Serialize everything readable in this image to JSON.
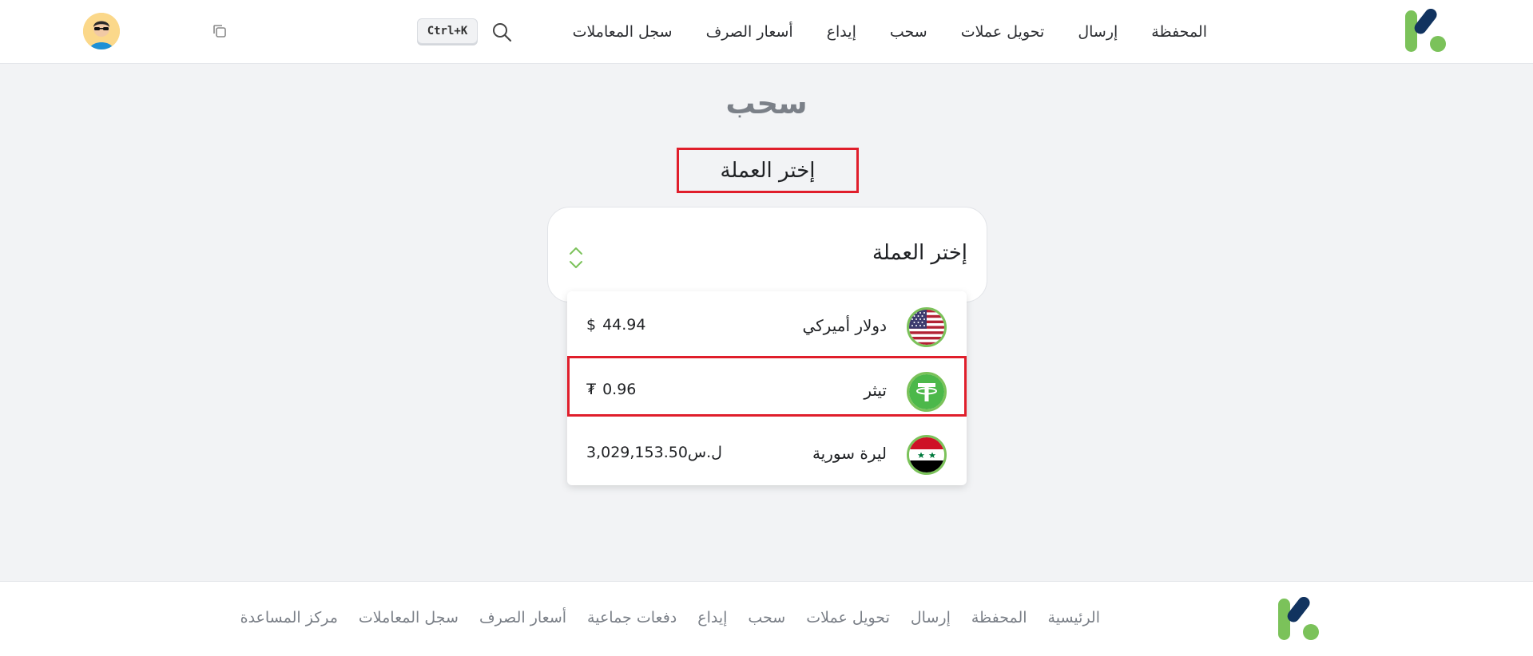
{
  "header": {
    "nav": [
      {
        "label": "المحفظة"
      },
      {
        "label": "إرسال"
      },
      {
        "label": "تحويل عملات"
      },
      {
        "label": "سحب"
      },
      {
        "label": "إيداع"
      },
      {
        "label": "أسعار الصرف"
      },
      {
        "label": "سجل المعاملات"
      }
    ],
    "shortcut": "Ctrl+K"
  },
  "main": {
    "title": "سحب",
    "section_label": "إختر العملة",
    "select": {
      "value": "إختر العملة"
    },
    "currencies": [
      {
        "name": "دولار أميركي",
        "amount": "44.94",
        "symbol": "$",
        "selected": false,
        "flag": "us-flag-icon"
      },
      {
        "name": "تيثر",
        "amount": "0.96",
        "symbol": "₮",
        "selected": true,
        "flag": "tether-icon"
      },
      {
        "name": "ليرة سورية",
        "amount": "3,029,153.50",
        "symbol": "ل.س",
        "selected": false,
        "flag": "syria-flag-icon"
      }
    ]
  },
  "footer": {
    "links": [
      {
        "label": "الرئيسية"
      },
      {
        "label": "المحفظة"
      },
      {
        "label": "إرسال"
      },
      {
        "label": "تحويل عملات"
      },
      {
        "label": "سحب"
      },
      {
        "label": "إيداع"
      },
      {
        "label": "دفعات جماعية"
      },
      {
        "label": "أسعار الصرف"
      },
      {
        "label": "سجل المعاملات"
      },
      {
        "label": "مركز المساعدة"
      }
    ]
  },
  "colors": {
    "brand_green": "#7bc25a",
    "brand_navy": "#11335f",
    "highlight_red": "#e01e2b"
  }
}
